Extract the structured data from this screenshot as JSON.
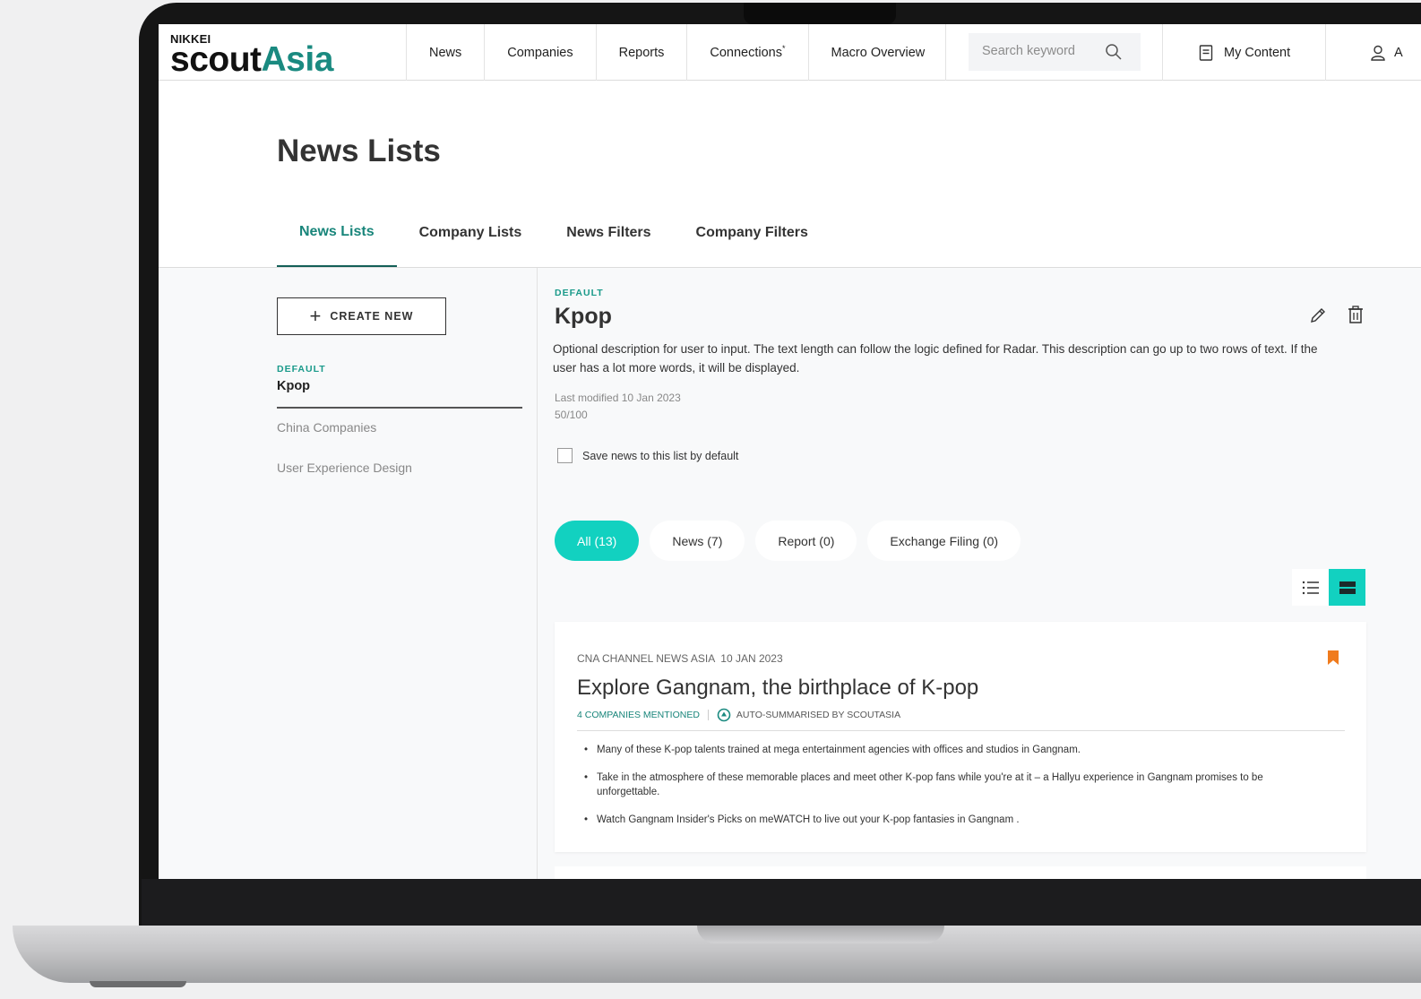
{
  "brand": {
    "nikkei": "NIKKEI",
    "scout": "scout",
    "asia": "Asia"
  },
  "nav": {
    "items": [
      "News",
      "Companies",
      "Reports",
      "Connections",
      "Macro Overview"
    ],
    "connections_marker": "*",
    "search_placeholder": "Search keyword",
    "my_content": "My Content",
    "account": "A"
  },
  "page": {
    "title": "News Lists"
  },
  "tabs": [
    "News Lists",
    "Company Lists",
    "News Filters",
    "Company Filters"
  ],
  "sidebar": {
    "create_label": "CREATE NEW",
    "default_tag": "DEFAULT",
    "selected": "Kpop",
    "items": [
      "China Companies",
      "User Experience Design"
    ]
  },
  "list": {
    "tag": "DEFAULT",
    "title": "Kpop",
    "description": "Optional description for user to input. The text length can follow the logic defined for Radar. This description can go up to two rows of text. If the user has a lot more words, it will be displayed.",
    "last_modified": "Last modified 10 Jan 2023",
    "count": "50/100",
    "save_default_label": "Save news to this list by default",
    "save_default_checked": false
  },
  "filters": [
    "All (13)",
    "News (7)",
    "Report (0)",
    "Exchange Filing (0)"
  ],
  "active_filter": "All (13)",
  "view_mode": "card",
  "colors": {
    "accent": "#12d1c0",
    "brand": "#18857a",
    "bookmark": "#f07b1d"
  },
  "articles": [
    {
      "source": "CNA CHANNEL NEWS ASIA",
      "date": "10 JAN 2023",
      "title": "Explore Gangnam, the birthplace of K-pop",
      "companies_mentioned": "4 COMPANIES MENTIONED",
      "auto_summary": "AUTO-SUMMARISED BY SCOUTASIA",
      "bullets": [
        "Many of these K-pop talents trained at mega entertainment agencies with offices and studios in Gangnam.",
        "Take in the atmosphere of these memorable places and meet other K-pop fans while you're at it – a Hallyu experience in Gangnam promises to be unforgettable.",
        "Watch Gangnam Insider's Picks on meWATCH to live out your K-pop fantasies in Gangnam ."
      ],
      "bookmarked": true
    }
  ]
}
